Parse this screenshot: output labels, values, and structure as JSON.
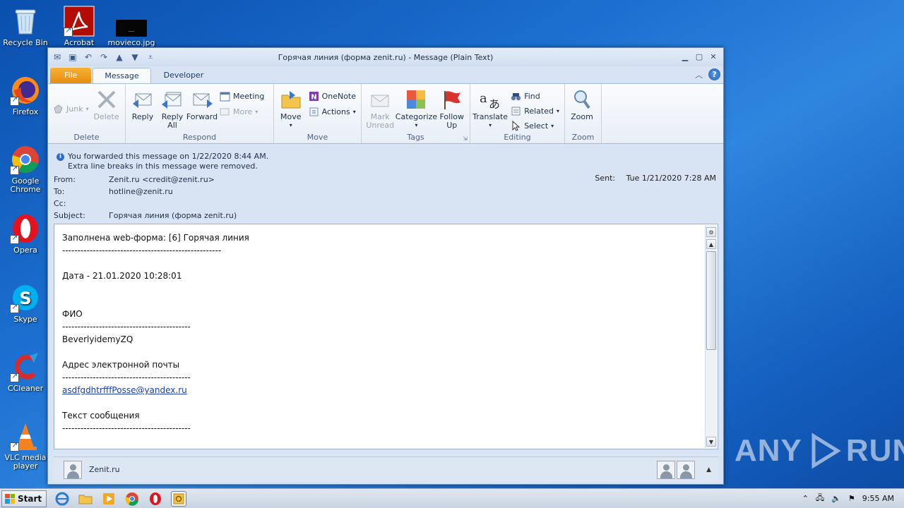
{
  "desktop": {
    "icons": [
      {
        "label": "Recycle Bin"
      },
      {
        "label": "Acrobat"
      },
      {
        "label": "movieco.jpg"
      },
      {
        "label": "Firefox"
      },
      {
        "label": "Google Chrome"
      },
      {
        "label": "Opera"
      },
      {
        "label": "Skype"
      },
      {
        "label": "CCleaner"
      },
      {
        "label": "VLC media player"
      }
    ],
    "watermark_left": "ANY",
    "watermark_right": "RUN"
  },
  "window": {
    "title": "Горячая линия (форма zenit.ru)  -  Message (Plain Text)"
  },
  "ribbon": {
    "tabs": [
      "File",
      "Message",
      "Developer"
    ],
    "groups": {
      "delete": {
        "label": "Delete",
        "junk": "Junk",
        "delete": "Delete"
      },
      "respond": {
        "label": "Respond",
        "reply": "Reply",
        "reply_all": "Reply All",
        "forward": "Forward",
        "meeting": "Meeting",
        "more": "More"
      },
      "move": {
        "label": "Move",
        "move": "Move",
        "onenote": "OneNote",
        "actions": "Actions"
      },
      "tags": {
        "label": "Tags",
        "mark_unread": "Mark Unread",
        "categorize": "Categorize",
        "follow_up": "Follow Up"
      },
      "editing": {
        "label": "Editing",
        "translate": "Translate",
        "find": "Find",
        "related": "Related",
        "select": "Select"
      },
      "zoom": {
        "label": "Zoom",
        "zoom": "Zoom"
      }
    }
  },
  "info": {
    "line1": "You forwarded this message on 1/22/2020 8:44 AM.",
    "line2": "Extra line breaks in this message were removed."
  },
  "header": {
    "from_label": "From:",
    "from_value": "Zenit.ru <credit@zenit.ru>",
    "to_label": "To:",
    "to_value": "hotline@zenit.ru",
    "cc_label": "Cc:",
    "cc_value": "",
    "subject_label": "Subject:",
    "subject_value": "Горячая линия (форма zenit.ru)",
    "sent_label": "Sent:",
    "sent_value": "Tue 1/21/2020 7:28 AM"
  },
  "body": {
    "line1": "Заполнена web-форма: [6] Горячая линия",
    "sep_long": "----------------------------------------------------",
    "line2": "Дата - 21.01.2020 10:28:01",
    "line3": "ФИО",
    "sep_short": "------------------------------------------",
    "line4": "BeverlyidemyZQ",
    "line5": "Адрес электронной почты",
    "email_link": "asdfgdhtrfffPosse@yandex.ru",
    "line6": "Текст сообщения"
  },
  "people_pane": {
    "name": "Zenit.ru"
  },
  "taskbar": {
    "start_label": "Start",
    "clock": "9:55 AM"
  }
}
